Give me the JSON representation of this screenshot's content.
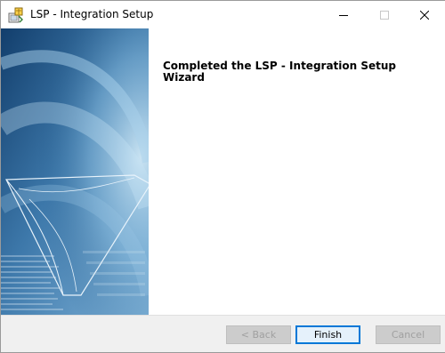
{
  "window": {
    "title": "LSP - Integration Setup",
    "icons": {
      "app": "installer-icon",
      "minimize": "minimize-icon",
      "maximize": "maximize-icon",
      "close": "close-icon"
    }
  },
  "content": {
    "heading": "Completed the LSP - Integration Setup Wizard"
  },
  "footer": {
    "back_label": "< Back",
    "finish_label": "Finish",
    "cancel_label": "Cancel"
  },
  "colors": {
    "accent": "#0078d7",
    "banner_dark": "#1b4a78",
    "banner_light": "#6fa6cf"
  }
}
